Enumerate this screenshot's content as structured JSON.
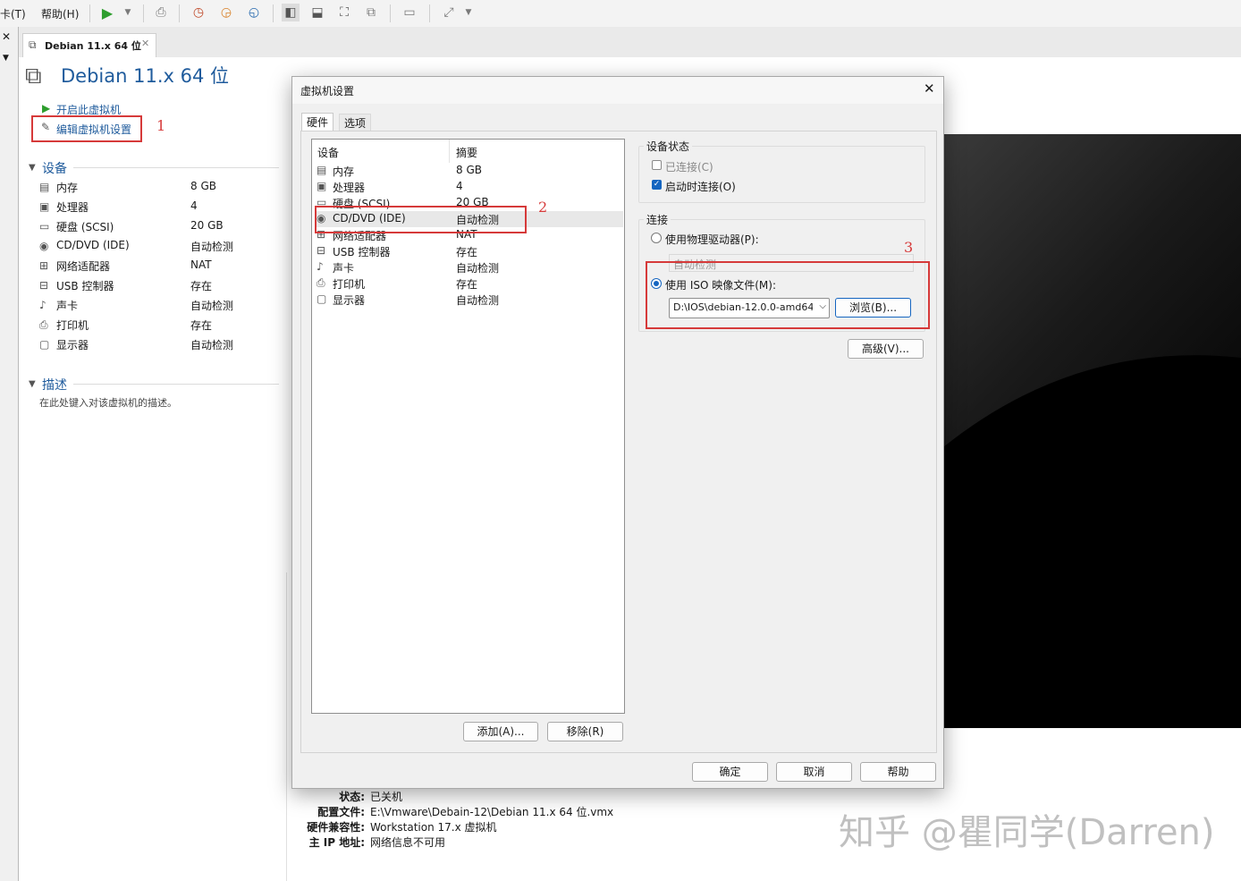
{
  "menubar": {
    "items": [
      "卡(T)",
      "帮助(H)"
    ]
  },
  "tab": {
    "label": "Debian 11.x 64 位",
    "close": "✕"
  },
  "vm": {
    "title": "Debian 11.x 64 位",
    "actions": {
      "power_on": "开启此虚拟机",
      "edit_settings": "编辑虚拟机设置"
    },
    "devices_section": "设备",
    "devices": [
      {
        "icon": "memory-icon",
        "name": "内存",
        "value": "8 GB"
      },
      {
        "icon": "cpu-icon",
        "name": "处理器",
        "value": "4"
      },
      {
        "icon": "harddisk-icon",
        "name": "硬盘 (SCSI)",
        "value": "20 GB"
      },
      {
        "icon": "cd-icon",
        "name": "CD/DVD (IDE)",
        "value": "自动检测"
      },
      {
        "icon": "network-icon",
        "name": "网络适配器",
        "value": "NAT"
      },
      {
        "icon": "usb-icon",
        "name": "USB 控制器",
        "value": "存在"
      },
      {
        "icon": "sound-icon",
        "name": "声卡",
        "value": "自动检测"
      },
      {
        "icon": "printer-icon",
        "name": "打印机",
        "value": "存在"
      },
      {
        "icon": "display-icon",
        "name": "显示器",
        "value": "自动检测"
      }
    ],
    "description_section": "描述",
    "description_placeholder": "在此处键入对该虚拟机的描述。"
  },
  "annotations": {
    "n1": "1",
    "n2": "2",
    "n3": "3"
  },
  "dialog": {
    "title": "虚拟机设置",
    "tabs": [
      "硬件",
      "选项"
    ],
    "list_headers": {
      "device": "设备",
      "summary": "摘要"
    },
    "devices": [
      {
        "name": "内存",
        "value": "8 GB"
      },
      {
        "name": "处理器",
        "value": "4"
      },
      {
        "name": "硬盘 (SCSI)",
        "value": "20 GB"
      },
      {
        "name": "CD/DVD (IDE)",
        "value": "自动检测"
      },
      {
        "name": "网络适配器",
        "value": "NAT"
      },
      {
        "name": "USB 控制器",
        "value": "存在"
      },
      {
        "name": "声卡",
        "value": "自动检测"
      },
      {
        "name": "打印机",
        "value": "存在"
      },
      {
        "name": "显示器",
        "value": "自动检测"
      }
    ],
    "add_button": "添加(A)...",
    "remove_button": "移除(R)",
    "device_status": {
      "label": "设备状态",
      "connected": "已连接(C)",
      "connect_on_power": "启动时连接(O)"
    },
    "connection": {
      "label": "连接",
      "physical_drive": "使用物理驱动器(P):",
      "physical_value": "自动检测",
      "iso_image": "使用 ISO 映像文件(M):",
      "iso_path": "D:\\IOS\\debian-12.0.0-amd64",
      "browse_button": "浏览(B)..."
    },
    "advanced_button": "高级(V)...",
    "ok_button": "确定",
    "cancel_button": "取消",
    "help_button": "帮助"
  },
  "status": {
    "state_label": "状态:",
    "state": "已关机",
    "config_label": "配置文件:",
    "config": "E:\\Vmware\\Debain-12\\Debian 11.x 64 位.vmx",
    "compat_label": "硬件兼容性:",
    "compat": "Workstation 17.x 虚拟机",
    "ip_label": "主 IP 地址:",
    "ip": "网络信息不可用"
  },
  "watermark": "知乎 @瞿同学(Darren)"
}
